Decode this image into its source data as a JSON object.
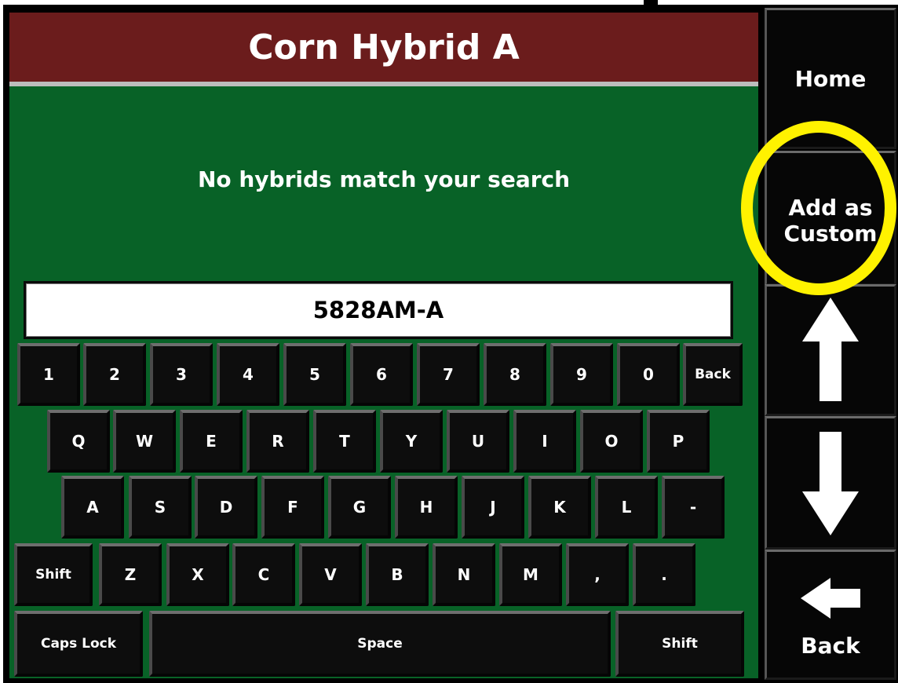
{
  "title": "Corn Hybrid A",
  "message": "No hybrids match your search",
  "search": {
    "value": "5828AM-A"
  },
  "keyboard": {
    "row1": [
      "1",
      "2",
      "3",
      "4",
      "5",
      "6",
      "7",
      "8",
      "9",
      "0",
      "Back"
    ],
    "row2": [
      "Q",
      "W",
      "E",
      "R",
      "T",
      "Y",
      "U",
      "I",
      "O",
      "P"
    ],
    "row3": [
      "A",
      "S",
      "D",
      "F",
      "G",
      "H",
      "J",
      "K",
      "L",
      "-"
    ],
    "row4": [
      "Shift",
      "Z",
      "X",
      "C",
      "V",
      "B",
      "N",
      "M",
      ",",
      "."
    ],
    "row5": [
      "Caps Lock",
      "Space",
      "Shift"
    ]
  },
  "sidebar": {
    "home_label": "Home",
    "add_custom_label": "Add as Custom",
    "up_icon": "arrow-up-icon",
    "down_icon": "arrow-down-icon",
    "back_icon": "arrow-left-icon",
    "back_label": "Back"
  },
  "colors": {
    "title_bar": "#6b1c1c",
    "panel_green": "#086227",
    "highlight": "#fff200",
    "button_black": "#060606"
  }
}
